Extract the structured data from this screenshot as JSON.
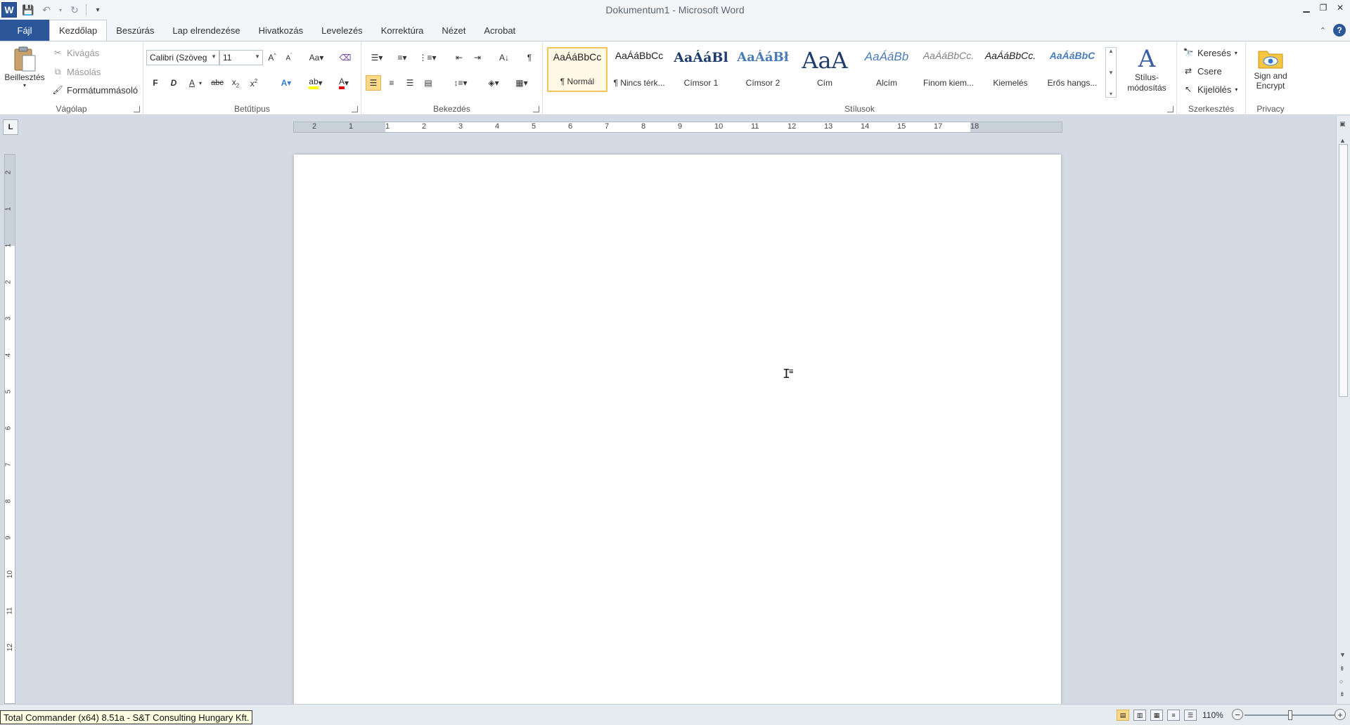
{
  "window": {
    "title": "Dokumentum1 - Microsoft Word",
    "app_logo": "W"
  },
  "tabs": {
    "file": "Fájl",
    "items": [
      "Kezdőlap",
      "Beszúrás",
      "Lap elrendezése",
      "Hivatkozás",
      "Levelezés",
      "Korrektúra",
      "Nézet",
      "Acrobat"
    ],
    "active": "Kezdőlap"
  },
  "clipboard": {
    "paste": "Beillesztés",
    "cut": "Kivágás",
    "copy": "Másolás",
    "format_painter": "Formátummásoló",
    "label": "Vágólap"
  },
  "font": {
    "name": "Calibri (Szöveg",
    "size": "11",
    "bold": "F",
    "italic": "D",
    "underline": "A",
    "strike": "abc",
    "label": "Betűtípus"
  },
  "paragraph": {
    "label": "Bekezdés"
  },
  "styles": {
    "label": "Stílusok",
    "items": [
      {
        "preview": "AaÁáBbCc",
        "name": "¶ Normál"
      },
      {
        "preview": "AaÁáBbCc",
        "name": "¶ Nincs térk..."
      },
      {
        "preview": "AaÁáBl",
        "name": "Címsor 1"
      },
      {
        "preview": "AaÁáBł",
        "name": "Címsor 2"
      },
      {
        "preview": "AaA",
        "name": "Cím"
      },
      {
        "preview": "AaÁáBb",
        "name": "Alcím"
      },
      {
        "preview": "AaÁáBbCc.",
        "name": "Finom kiem..."
      },
      {
        "preview": "AaÁáBbCc.",
        "name": "Kiemelés"
      },
      {
        "preview": "AaÁáBbC",
        "name": "Erős hangs..."
      }
    ],
    "change": "Stílus-\nmódosítás"
  },
  "editing": {
    "label": "Szerkesztés",
    "find": "Keresés",
    "replace": "Csere",
    "select": "Kijelölés"
  },
  "privacy": {
    "label": "Privacy",
    "sign": "Sign and",
    "encrypt": "Encrypt"
  },
  "ruler": {
    "corner": "L",
    "h_ticks": [
      "2",
      "1",
      "1",
      "2",
      "3",
      "4",
      "5",
      "6",
      "7",
      "8",
      "9",
      "10",
      "11",
      "12",
      "13",
      "14",
      "15",
      "17",
      "18"
    ],
    "v_ticks": [
      "2",
      "1",
      "1",
      "2",
      "3",
      "4",
      "5",
      "6",
      "7",
      "8",
      "9",
      "10",
      "11",
      "12"
    ]
  },
  "statusbar": {
    "tooltip": "Total Commander (x64) 8.51a - S&T Consulting Hungary Kft.",
    "zoom": "110%"
  }
}
